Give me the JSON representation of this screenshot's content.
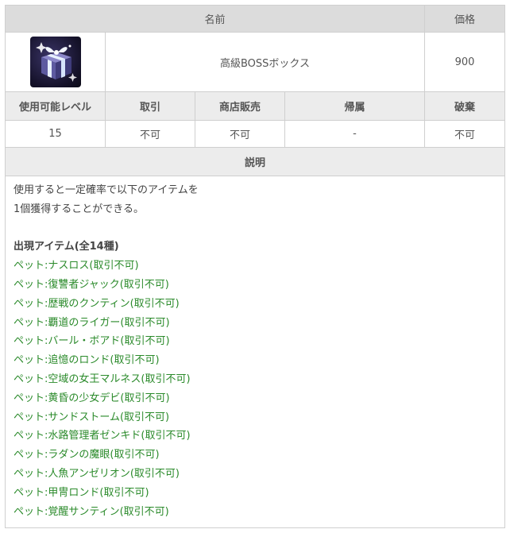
{
  "header": {
    "name_col": "名前",
    "price_col": "価格"
  },
  "item": {
    "name": "高級BOSSボックス",
    "price": "900",
    "icon": "gift-box-icon"
  },
  "attr_headers": [
    "使用可能レベル",
    "取引",
    "商店販売",
    "帰属",
    "破棄"
  ],
  "attr_values": [
    "15",
    "不可",
    "不可",
    "-",
    "不可"
  ],
  "description": {
    "header": "説明",
    "lines": [
      "使用すると一定確率で以下のアイテムを",
      "1個獲得することができる。"
    ],
    "items_title": "出現アイテム(全14種)",
    "items": [
      "ペット:ナスロス(取引不可)",
      "ペット:復讐者ジャック(取引不可)",
      "ペット:歴戦のクンティン(取引不可)",
      "ペット:覇道のライガー(取引不可)",
      "ペット:バール・ボアド(取引不可)",
      "ペット:追憶のロンド(取引不可)",
      "ペット:空域の女王マルネス(取引不可)",
      "ペット:黄昏の少女デビ(取引不可)",
      "ペット:サンドストーム(取引不可)",
      "ペット:水路管理者ゼンキド(取引不可)",
      "ペット:ラダンの魔眼(取引不可)",
      "ペット:人魚アンゼリオン(取引不可)",
      "ペット:甲冑ロンド(取引不可)",
      "ペット:覚醒サンティン(取引不可)"
    ]
  },
  "colors": {
    "header_bg": "#dcdcdc",
    "subheader_bg": "#ececec",
    "item_text": "#2a8a2a",
    "border": "#cfcfcf"
  }
}
